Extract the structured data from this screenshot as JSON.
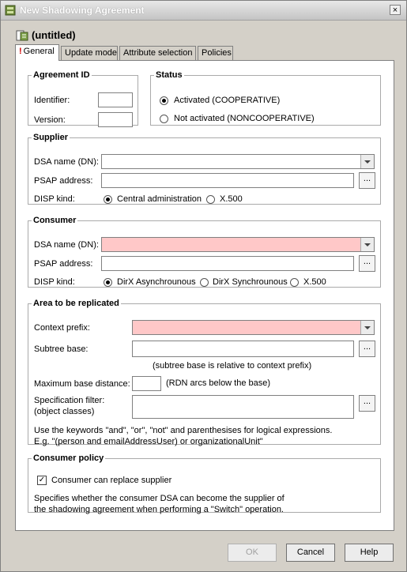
{
  "window": {
    "title": "New Shadowing Agreement",
    "close_label": "×"
  },
  "heading": {
    "title": "(untitled)"
  },
  "tabs": [
    {
      "label": "General",
      "alert": "!"
    },
    {
      "label": "Update mode"
    },
    {
      "label": "Attribute selection"
    },
    {
      "label": "Policies"
    }
  ],
  "agreement_id": {
    "legend": "Agreement ID",
    "identifier_label": "Identifier:",
    "identifier_value": "",
    "version_label": "Version:",
    "version_value": ""
  },
  "status": {
    "legend": "Status",
    "option_activated": "Activated (COOPERATIVE)",
    "option_not_activated": "Not activated (NONCOOPERATIVE)",
    "selected": "activated"
  },
  "supplier": {
    "legend": "Supplier",
    "dsa_label": "DSA name (DN):",
    "dsa_value": "",
    "psap_label": "PSAP address:",
    "psap_value": "",
    "disp_label": "DISP kind:",
    "disp_options": [
      "Central administration",
      "X.500"
    ],
    "disp_selected": 0,
    "browse": "..."
  },
  "consumer": {
    "legend": "Consumer",
    "dsa_label": "DSA name (DN):",
    "dsa_value": "",
    "psap_label": "PSAP address:",
    "psap_value": "",
    "disp_label": "DISP kind:",
    "disp_options": [
      "DirX Asynchrounous",
      "DirX Synchrounous",
      "X.500"
    ],
    "disp_selected": 0,
    "browse": "..."
  },
  "area": {
    "legend": "Area to be replicated",
    "context_label": "Context prefix:",
    "context_value": "",
    "subtree_label": "Subtree base:",
    "subtree_value": "",
    "subtree_note": "(subtree base is relative to context prefix)",
    "maxdist_label": "Maximum base distance:",
    "maxdist_value": "",
    "maxdist_note": "(RDN arcs below the base)",
    "filter_label_1": "Specification filter:",
    "filter_label_2": "(object classes)",
    "filter_value": "",
    "filter_note_1": "Use the keywords \"and\", \"or\", \"not\" and parenthesises for logical expressions.",
    "filter_note_2": "E.g. \"(person and emailAddressUser) or organizationalUnit\"",
    "browse": "..."
  },
  "policy": {
    "legend": "Consumer policy",
    "checkbox_label": "Consumer can replace supplier",
    "checked": true,
    "note_1": "Specifies whether the consumer DSA can become the supplier of",
    "note_2": "the shadowing agreement when performing a \"Switch\" operation."
  },
  "buttons": {
    "ok": "OK",
    "cancel": "Cancel",
    "help": "Help"
  },
  "colors": {
    "required_field": "#ffc8c8",
    "tab_alert": "#d00000"
  }
}
